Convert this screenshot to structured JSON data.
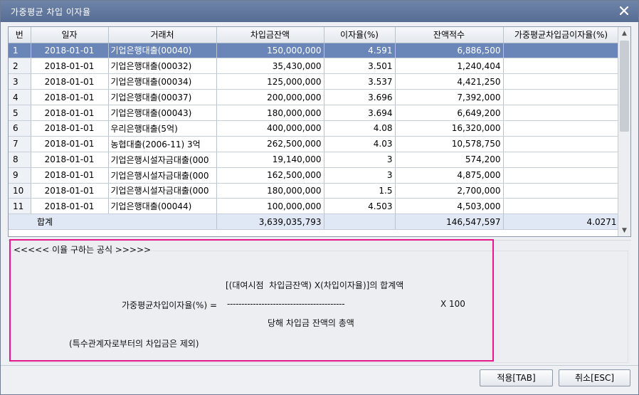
{
  "window": {
    "title": "가중평균 차입 이자율"
  },
  "grid": {
    "columns": [
      "번",
      "일자",
      "거래처",
      "차입금잔액",
      "이자율(%)",
      "잔액적수",
      "가중평균차입금이자율(%)"
    ],
    "rows": [
      {
        "no": "1",
        "date": "2018-01-01",
        "vendor": "기업은행대출(00040)",
        "balance": "150,000,000",
        "rate": "4.591",
        "accum": "6,886,500",
        "wavg": ""
      },
      {
        "no": "2",
        "date": "2018-01-01",
        "vendor": "기업은행대출(00032)",
        "balance": "35,430,000",
        "rate": "3.501",
        "accum": "1,240,404",
        "wavg": ""
      },
      {
        "no": "3",
        "date": "2018-01-01",
        "vendor": "기업은행대출(00034)",
        "balance": "125,000,000",
        "rate": "3.537",
        "accum": "4,421,250",
        "wavg": ""
      },
      {
        "no": "4",
        "date": "2018-01-01",
        "vendor": "기업은행대출(00037)",
        "balance": "200,000,000",
        "rate": "3.696",
        "accum": "7,392,000",
        "wavg": ""
      },
      {
        "no": "5",
        "date": "2018-01-01",
        "vendor": "기업은행대출(00043)",
        "balance": "180,000,000",
        "rate": "3.694",
        "accum": "6,649,200",
        "wavg": ""
      },
      {
        "no": "6",
        "date": "2018-01-01",
        "vendor": "우리은행대출(5억)",
        "balance": "400,000,000",
        "rate": "4.08",
        "accum": "16,320,000",
        "wavg": ""
      },
      {
        "no": "7",
        "date": "2018-01-01",
        "vendor": "농협대출(2006-11) 3억",
        "balance": "262,500,000",
        "rate": "4.03",
        "accum": "10,578,750",
        "wavg": ""
      },
      {
        "no": "8",
        "date": "2018-01-01",
        "vendor": "기업은행시설자금대출(000",
        "balance": "19,140,000",
        "rate": "3",
        "accum": "574,200",
        "wavg": ""
      },
      {
        "no": "9",
        "date": "2018-01-01",
        "vendor": "기업은행시설자금대출(000",
        "balance": "162,500,000",
        "rate": "3",
        "accum": "4,875,000",
        "wavg": ""
      },
      {
        "no": "10",
        "date": "2018-01-01",
        "vendor": "기업은행시설자금대출(000",
        "balance": "180,000,000",
        "rate": "1.5",
        "accum": "2,700,000",
        "wavg": ""
      },
      {
        "no": "11",
        "date": "2018-01-01",
        "vendor": "기업은행대출(00044)",
        "balance": "100,000,000",
        "rate": "4.503",
        "accum": "4,503,000",
        "wavg": ""
      }
    ],
    "summary": {
      "label": "합계",
      "balance": "3,639,035,793",
      "accum": "146,547,597",
      "wavg": "4.0271"
    }
  },
  "formula": {
    "heading": "<<<<< 이율 구하는 공식 >>>>>",
    "numerator": "[(대여시점  차입금잔액) X(차입이자율)]의 합계액",
    "lhs": "가중평균차입이자율(%) =",
    "dashes": "-----------------------------------------",
    "multiplier": "X 100",
    "denominator": "당해 차입금 잔액의 총액",
    "note": "(특수관계자로부터의 차입금은 제외)"
  },
  "buttons": {
    "apply": "적용[TAB]",
    "cancel": "취소[ESC]"
  },
  "colors": {
    "titlebar": "#5f7498",
    "selected_row": "#6a85b8",
    "summary_row": "#dfe8f4",
    "highlight_border": "#e6198a"
  }
}
